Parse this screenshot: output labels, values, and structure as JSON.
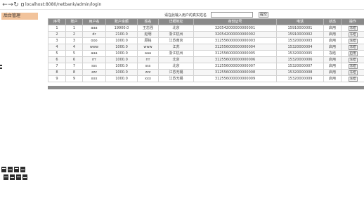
{
  "browser": {
    "back": "←",
    "forward": "→",
    "reload": "↻",
    "url": "localhost:8080/netbank/admin/login"
  },
  "sidebar": {
    "items": [
      {
        "label": "后台管理"
      }
    ]
  },
  "search": {
    "label": "请在此输入用户的真实姓名",
    "button_label": "提交"
  },
  "table": {
    "headers": [
      "序号",
      "账户",
      "用户名",
      "账户余额",
      "姓名",
      "详细地址",
      "身份证号",
      "电话",
      "状态",
      "操作"
    ],
    "rows": [
      [
        "1",
        "1",
        "aaa",
        "19900.0",
        "王志强",
        "北京",
        "320542000000000001",
        "15910000001",
        "启用",
        "冻结"
      ],
      [
        "2",
        "2",
        "dr",
        "2100.0",
        "赵明",
        "浙江杭州",
        "320542000000000002",
        "15910000002",
        "启用",
        "冻结"
      ],
      [
        "3",
        "3",
        "ooo",
        "1000.0",
        "顾铭",
        "江苏南京",
        "312556000000000003",
        "15320000003",
        "启用",
        "冻结"
      ],
      [
        "4",
        "4",
        "www",
        "1000.0",
        "www",
        "江苏",
        "312556000000000004",
        "15320000004",
        "启用",
        "冻结"
      ],
      [
        "5",
        "5",
        "aaa",
        "1000.0",
        "aaa",
        "浙江杭州",
        "312556000000000005",
        "15320000005",
        "冻结",
        "启用"
      ],
      [
        "6",
        "6",
        "rrr",
        "1000.0",
        "rrr",
        "北京",
        "312556000000000006",
        "15320000006",
        "启用",
        "冻结"
      ],
      [
        "7",
        "7",
        "sss",
        "1000.0",
        "sss",
        "北京",
        "312556000000000007",
        "15320000007",
        "启用",
        "冻结"
      ],
      [
        "8",
        "8",
        "zzz",
        "1000.0",
        "zzz",
        "江苏无锡",
        "312556000000000008",
        "15320000008",
        "启用",
        "冻结"
      ],
      [
        "9",
        "9",
        "xxx",
        "1000.0",
        "xxx",
        "江苏无锡",
        "312556000000000009",
        "15320000009",
        "启用",
        "冻结"
      ]
    ]
  },
  "colors": {
    "header_bg": "#8a8a8a",
    "sidebar_active": "#f2c39b"
  },
  "icons": {
    "lock": "lock-icon",
    "watermark": "watermark-logo"
  }
}
